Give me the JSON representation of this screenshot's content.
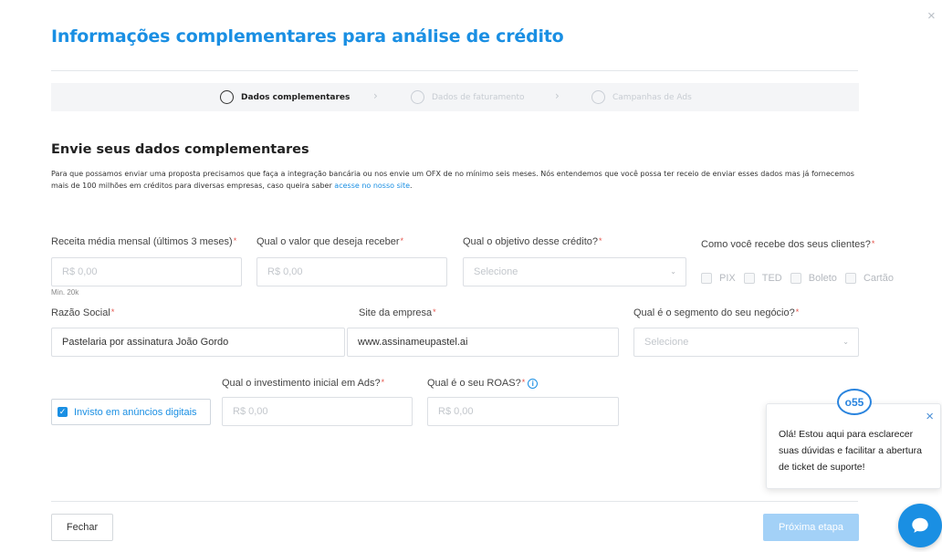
{
  "modal": {
    "title": "Informações complementares para análise de crédito",
    "close_icon": "×"
  },
  "steps": [
    {
      "label": "Dados complementares",
      "state": "active"
    },
    {
      "label": "Dados de faturamento",
      "state": "inactive"
    },
    {
      "label": "Campanhas de Ads",
      "state": "inactive"
    }
  ],
  "section": {
    "title": "Envie seus dados complementares",
    "description": "Para que possamos enviar uma proposta precisamos que faça a integração bancária ou nos envie um OFX de no mínimo seis meses. Nós entendemos que você possa ter receio de enviar esses dados mas já fornecemos mais de 100 milhões em créditos para diversas empresas, caso queira saber ",
    "description_link": "acesse no nosso site",
    "description_end": "."
  },
  "form": {
    "receita": {
      "label": "Receita média mensal (últimos 3 meses)",
      "placeholder": "R$ 0,00",
      "hint": "Min. 20k"
    },
    "valor": {
      "label": "Qual o valor que deseja receber",
      "placeholder": "R$ 0,00"
    },
    "objetivo": {
      "label": "Qual o objetivo desse crédito?",
      "placeholder": "Selecione"
    },
    "recebimento": {
      "label": "Como você recebe dos seus clientes?",
      "options": [
        "PIX",
        "TED",
        "Boleto",
        "Cartão"
      ]
    },
    "razao_social": {
      "label": "Razão Social",
      "value": "Pastelaria por assinatura João Gordo"
    },
    "site": {
      "label": "Site da empresa",
      "value": "www.assinameupastel.ai"
    },
    "segmento": {
      "label": "Qual é o segmento do seu negócio?",
      "placeholder": "Selecione"
    },
    "investe_ads": {
      "label": "Invisto em anúncios digitais",
      "checked": true
    },
    "investimento": {
      "label": "Qual o investimento inicial em Ads?",
      "placeholder": "R$ 0,00"
    },
    "roas": {
      "label": "Qual é o seu ROAS?",
      "placeholder": "R$ 0,00"
    },
    "required_mark": "*"
  },
  "footer": {
    "close_label": "Fechar",
    "next_label": "Próxima etapa"
  },
  "chat": {
    "logo_text": "o55",
    "message": "Olá! Estou aqui para esclarecer suas dúvidas e facilitar a abertura de ticket de suporte!",
    "close_icon": "×"
  },
  "colors": {
    "accent": "#1a8fe3",
    "required": "#e5534b",
    "next_disabled": "#a3d1f7"
  }
}
